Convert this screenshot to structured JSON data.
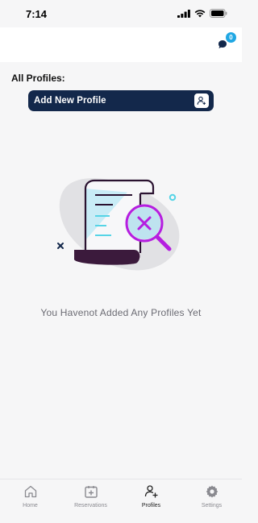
{
  "status_bar": {
    "time": "7:14"
  },
  "header": {
    "chat_icon": "chat-bubble-icon",
    "chat_badge_count": "0"
  },
  "main": {
    "section_title": "All Profiles:",
    "add_button_label": "Add New Profile",
    "add_button_icon": "add-user-icon",
    "empty_message": "You Havenot Added Any Profiles Yet"
  },
  "bottom_nav": {
    "items": [
      {
        "label": "Home",
        "icon": "home-icon"
      },
      {
        "label": "Reservations",
        "icon": "calendar-plus-icon"
      },
      {
        "label": "Profiles",
        "icon": "profiles-icon",
        "active": true
      },
      {
        "label": "Settings",
        "icon": "gear-icon"
      }
    ]
  },
  "colors": {
    "primary": "#13284b",
    "badge": "#20a7e3",
    "illustration_purple": "#b51ee0",
    "illustration_dark": "#3b1a3c",
    "illustration_cyan": "#56d4e6"
  }
}
